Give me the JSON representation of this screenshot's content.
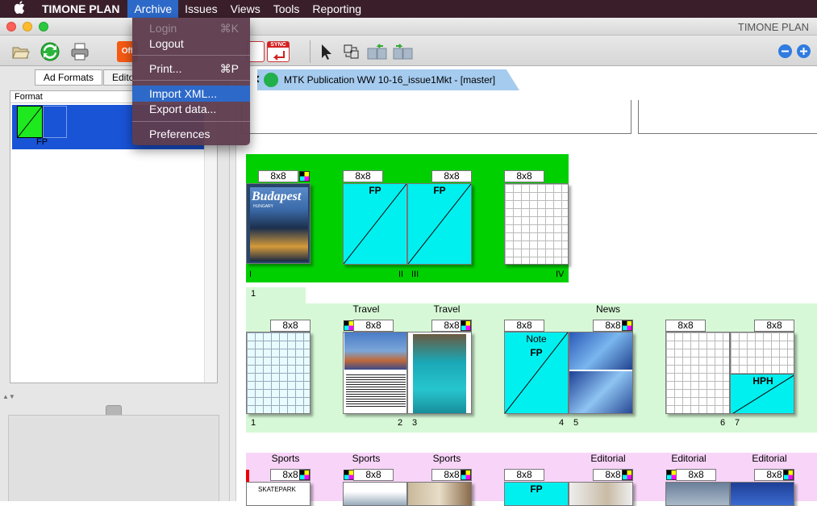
{
  "menubar": {
    "apple": "",
    "app_name": "TIMONE PLAN",
    "items": [
      "Archive",
      "Issues",
      "Views",
      "Tools",
      "Reporting"
    ]
  },
  "window": {
    "title": "TIMONE PLAN"
  },
  "archive_menu": {
    "login": {
      "label": "Login",
      "shortcut": "⌘K"
    },
    "logout": "Logout",
    "print": {
      "label": "Print...",
      "shortcut": "⌘P"
    },
    "import_xml": "Import XML...",
    "export_data": "Export data...",
    "preferences": "Preferences"
  },
  "left_panel": {
    "tabs": [
      "Ad Formats",
      "Edito"
    ],
    "format_header": "Format",
    "format_item": "FP"
  },
  "document_tab": {
    "close": "✕",
    "label": "MTK Publication WW 10-16_issue1Mkt - [master]"
  },
  "toolbar": {
    "sync_label": "SYNC",
    "off_label": "Off"
  },
  "colors": {
    "green_section": "#00d000",
    "light_green": "#d6f8d6",
    "pink": "#f8d4f8",
    "cyan": "#00f0f0",
    "selection": "#1953d6"
  },
  "section1": {
    "sizes": [
      "8x8",
      "8x8",
      "8x8",
      "8x8"
    ],
    "ad_labels": [
      "FP",
      "FP"
    ],
    "cover_title": "Budapest",
    "cover_sub": "HUNGARY",
    "page_labels": [
      "I",
      "II",
      "III",
      "IV"
    ]
  },
  "section2": {
    "number": "1",
    "headers": [
      "Travel",
      "Travel",
      "News"
    ],
    "sizes": [
      "8x8",
      "8x8",
      "8x8",
      "8x8",
      "8x8",
      "8x8",
      "8x8"
    ],
    "note": "Note",
    "fp": "FP",
    "hph": "HPH",
    "page_numbers": [
      "1",
      "2",
      "3",
      "4",
      "5",
      "6",
      "7"
    ]
  },
  "section3": {
    "headers": [
      "Sports",
      "Sports",
      "Sports",
      "Editorial",
      "Editorial",
      "Editorial"
    ],
    "sizes": [
      "8x8",
      "8x8",
      "8x8",
      "8x8",
      "8x8",
      "8x8",
      "8x8"
    ],
    "fp": "FP",
    "thumb_text": "SKATEPARK"
  }
}
